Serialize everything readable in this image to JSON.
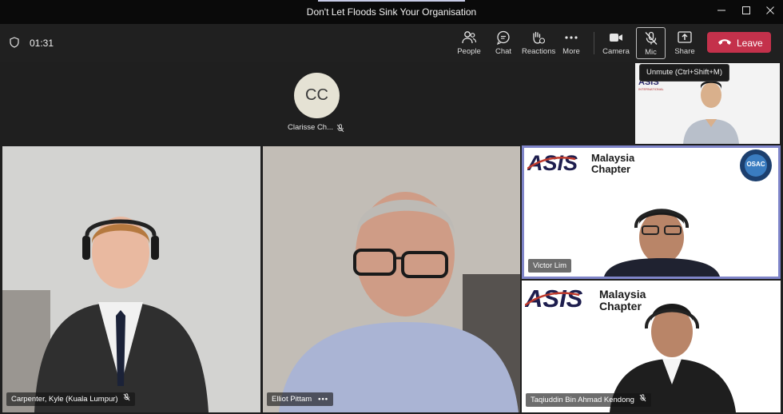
{
  "window": {
    "title": "Don't Let Floods Sink Your Organisation",
    "controls": [
      "minimize-icon",
      "maximize-icon",
      "close-icon"
    ]
  },
  "toolbar": {
    "timer": "01:31",
    "buttons": {
      "people": "People",
      "chat": "Chat",
      "reactions": "Reactions",
      "more": "More",
      "camera": "Camera",
      "mic": "Mic",
      "share": "Share"
    },
    "leave_label": "Leave",
    "leave_color": "#c4314b"
  },
  "tooltip": {
    "text": "Unmute (Ctrl+Shift+M)"
  },
  "stage": {
    "avatar_initials": "CC",
    "avatar_name": "Clarisse Ch..."
  },
  "tiles": [
    {
      "name": "Carpenter, Kyle (Kuala Lumpur)",
      "muted": true
    },
    {
      "name": "Elliot Pittam",
      "more": "•••"
    },
    {
      "name": "Victor Lim",
      "active_speaker": true,
      "highlight_color": "#7f85c9"
    },
    {
      "name": "Taqiuddin Bin Ahmad Kendong",
      "muted": true
    }
  ],
  "branding": {
    "logo_text": "ASIS",
    "logo_sub": "INTERNATIONAL",
    "chapter_line1": "Malaysia",
    "chapter_line2": "Chapter",
    "badge_text": "OSAC"
  }
}
